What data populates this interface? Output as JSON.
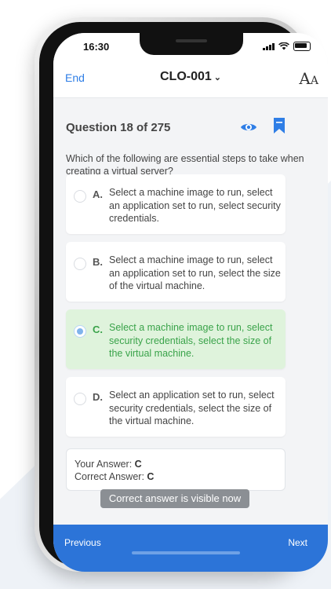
{
  "status": {
    "time": "16:30"
  },
  "nav": {
    "end_label": "End",
    "title": "CLO-001",
    "title_chevron": "⌄",
    "font_icon_label": "AA"
  },
  "question": {
    "header": "Question 18 of 275",
    "text": "Which of the following are essential steps to take when creating a virtual server?"
  },
  "options": [
    {
      "letter": "A.",
      "text": "Select a machine image to run, select an application set to run, select security credentials.",
      "selected": false,
      "correct": false
    },
    {
      "letter": "B.",
      "text": "Select a machine image to run, select an application set to run, select the size of the virtual machine.",
      "selected": false,
      "correct": false
    },
    {
      "letter": "C.",
      "text": "Select a machine image to run, select security credentials, select the size of the virtual machine.",
      "selected": true,
      "correct": true
    },
    {
      "letter": "D.",
      "text": "Select an application set to run, select security credentials, select the size of the virtual machine.",
      "selected": false,
      "correct": false
    }
  ],
  "answers": {
    "your_label": "Your Answer: ",
    "your_value": "C",
    "correct_label": "Correct Answer: ",
    "correct_value": "C"
  },
  "toast": "Correct answer is visible now",
  "bottom": {
    "previous": "Previous",
    "next": "Next"
  },
  "colors": {
    "accent": "#2f7ee6",
    "bar": "#2c74d8",
    "correct_bg": "#dff3dc",
    "correct_text": "#3aa34a"
  },
  "icons": {
    "eye": "eye-icon",
    "bookmark": "bookmark-icon",
    "font_size": "font-size-icon",
    "chevron": "chevron-down-icon"
  }
}
